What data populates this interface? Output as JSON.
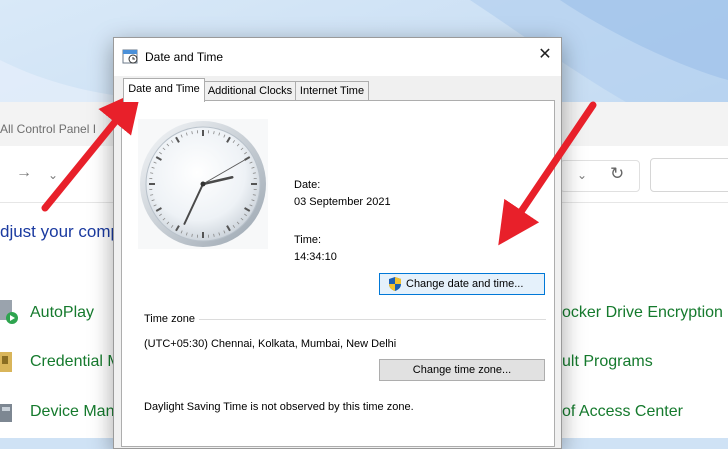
{
  "control_panel": {
    "title_fragment": "All Control Panel I",
    "back_icon": "arrow-right-icon",
    "heading_fragment": "djust your compu",
    "left_items": [
      {
        "label": "AutoPlay",
        "icon": "autoplay-icon"
      },
      {
        "label": "Credential M",
        "icon": "credential-manager-icon"
      },
      {
        "label": "Device Mana",
        "icon": "device-manager-icon"
      }
    ],
    "right_items": [
      {
        "label": "ocker Drive Encryption"
      },
      {
        "label": "ult Programs"
      },
      {
        "label": "of Access Center"
      }
    ]
  },
  "dialog": {
    "title": "Date and Time",
    "close_icon": "close-icon",
    "tabs": [
      {
        "label": "Date and Time",
        "active": true
      },
      {
        "label": "Additional Clocks",
        "active": false
      },
      {
        "label": "Internet Time",
        "active": false
      }
    ],
    "date_label": "Date:",
    "date_value": "03 September 2021",
    "time_label": "Time:",
    "time_value": "14:34:10",
    "change_datetime_button": "Change date and time...",
    "timezone_group_label": "Time zone",
    "timezone_value": "(UTC+05:30) Chennai, Kolkata, Mumbai, New Delhi",
    "change_timezone_button": "Change time zone...",
    "dst_note": "Daylight Saving Time is not observed by this time zone."
  },
  "clock": {
    "hour": 14,
    "minute": 34,
    "second": 10
  },
  "annotation_color": "#e8202a"
}
